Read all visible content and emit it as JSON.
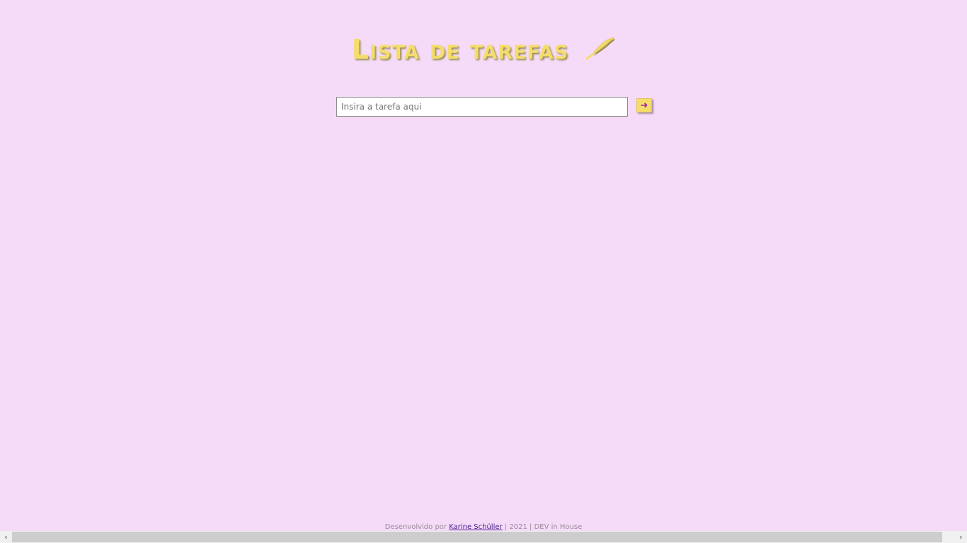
{
  "header": {
    "title": "Lista de tarefas",
    "title_icon": "quill-pen-icon",
    "title_color": "#f5dd6c"
  },
  "task_form": {
    "placeholder": "Insira a tarefa aqui",
    "value": "",
    "submit_label": "➜",
    "submit_icon": "arrow-right-icon",
    "button_color": "#f5dd6c",
    "arrow_color": "#a417a8"
  },
  "footer": {
    "prefix": "Desenvolvido por",
    "author": "Karine Schüller",
    "sep1": "|",
    "year": "2021",
    "sep2": "|",
    "org": "DEV in House"
  },
  "scrollbar": {
    "left_arrow": "‹",
    "right_arrow": "›"
  },
  "colors": {
    "background": "#f5dbf7"
  }
}
